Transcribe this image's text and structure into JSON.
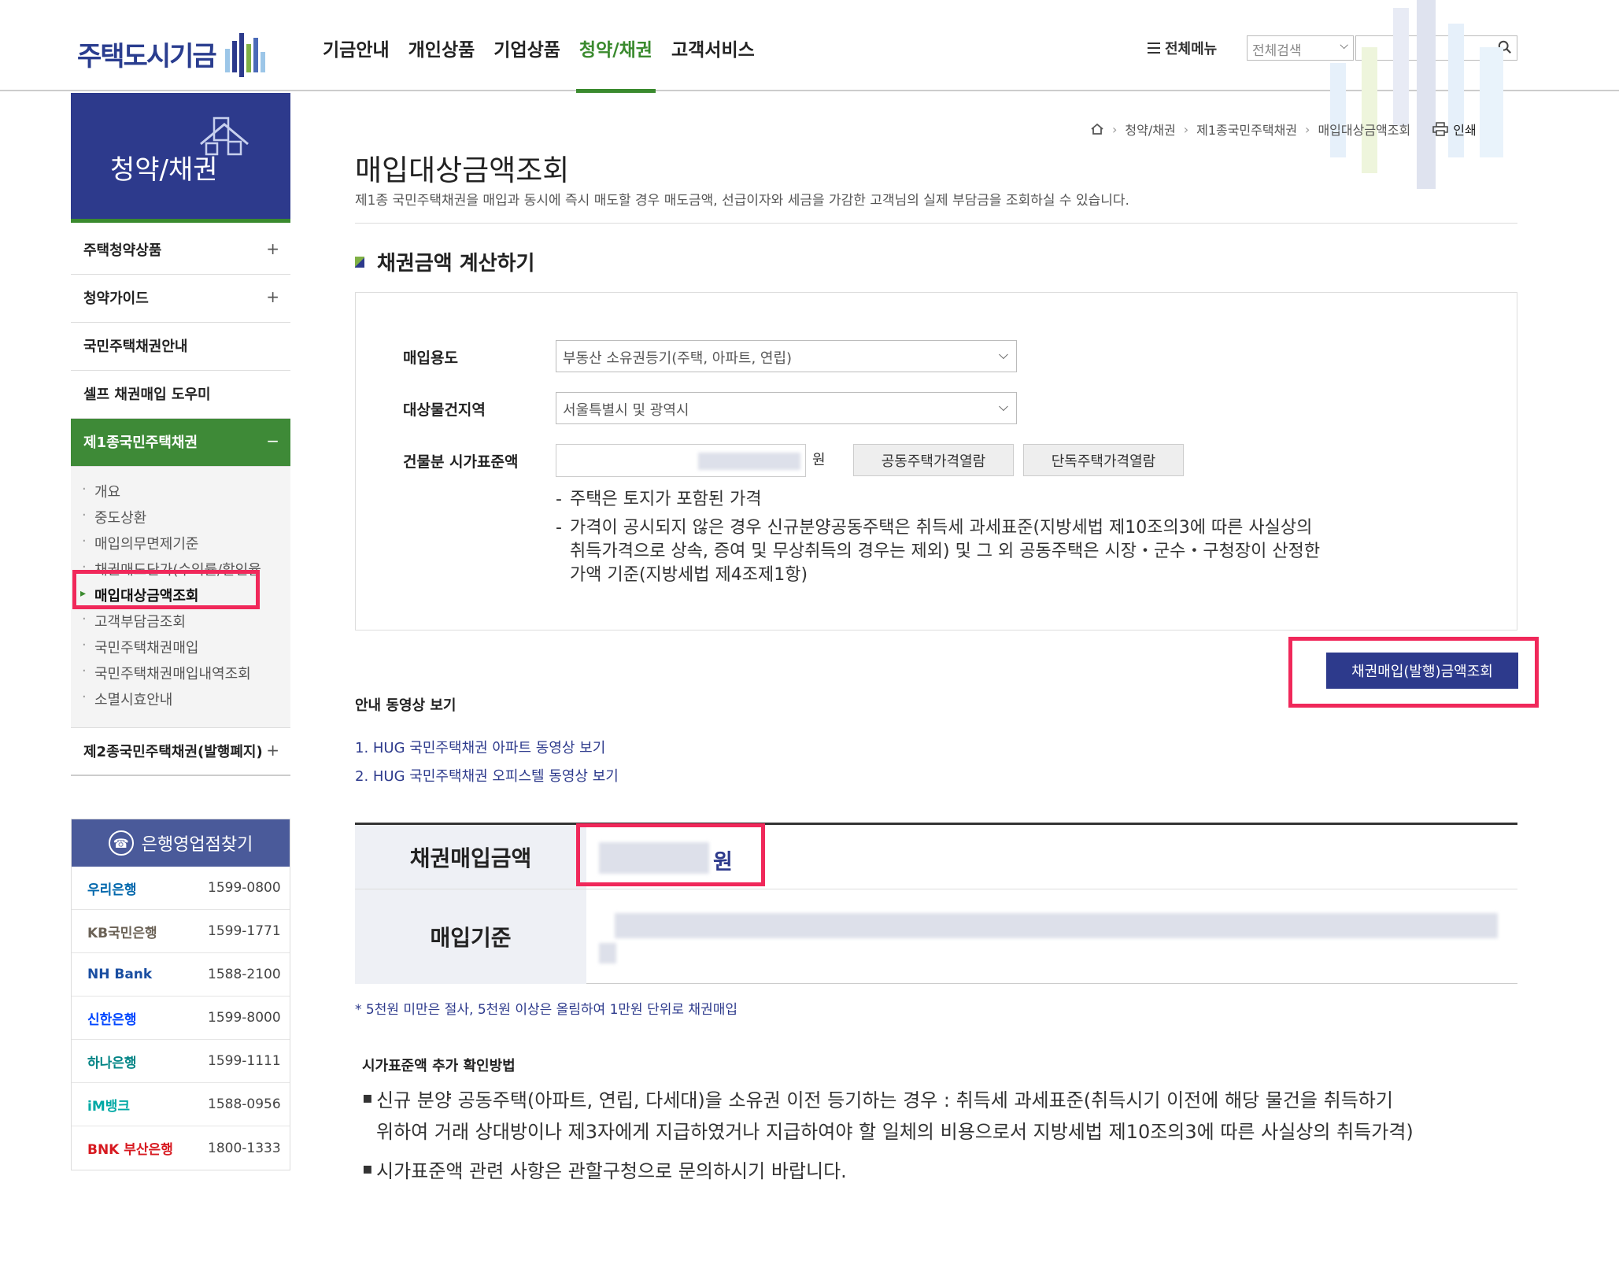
{
  "header": {
    "logo_text": "주택도시기금",
    "nav": [
      "기금안내",
      "개인상품",
      "기업상품",
      "청약/채권",
      "고객서비스"
    ],
    "nav_active": "청약/채권",
    "allmenu_label": "전체메뉴",
    "search_scope": "전체검색",
    "search_value": ""
  },
  "sidebar": {
    "banner_title": "청약/채권",
    "items": [
      {
        "label": "주택청약상품",
        "toggle": "+"
      },
      {
        "label": "청약가이드",
        "toggle": "+"
      },
      {
        "label": "국민주택채권안내",
        "toggle": ""
      },
      {
        "label": "셀프 채권매입 도우미",
        "toggle": ""
      },
      {
        "label": "제1종국민주택채권",
        "toggle": "−"
      }
    ],
    "sub_items": [
      "개요",
      "중도상환",
      "매입의무면제기준",
      "채권매도단가(수익률/할인율",
      "매입대상금액조회",
      "고객부담금조회",
      "국민주택채권매입",
      "국민주택채권매입내역조회",
      "소멸시효안내"
    ],
    "sub_active": "매입대상금액조회",
    "last_item": {
      "label": "제2종국민주택채권(발행폐지)",
      "toggle": "+"
    }
  },
  "banks": {
    "title": "은행영업점찾기",
    "rows": [
      {
        "name": "우리은행",
        "tel": "1599-0800",
        "color": "#0067ac"
      },
      {
        "name": "KB국민은행",
        "tel": "1599-1771",
        "color": "#6b6256"
      },
      {
        "name": "NH Bank",
        "tel": "1588-2100",
        "color": "#1a4ea1"
      },
      {
        "name": "신한은행",
        "tel": "1599-8000",
        "color": "#0046ff"
      },
      {
        "name": "하나은행",
        "tel": "1599-1111",
        "color": "#008485"
      },
      {
        "name": "iM뱅크",
        "tel": "1588-0956",
        "color": "#00a9a5"
      },
      {
        "name": "BNK 부산은행",
        "tel": "1800-1333",
        "color": "#d71920"
      }
    ]
  },
  "breadcrumb": [
    "청약/채권",
    "제1종국민주택채권",
    "매입대상금액조회"
  ],
  "print_label": "인쇄",
  "page": {
    "title": "매입대상금액조회",
    "desc": "제1종 국민주택채권을 매입과 동시에 즉시 매도할 경우 매도금액, 선급이자와 세금을 가감한 고객님의 실제 부담금을 조회하실 수 있습니다.",
    "section_title": "채권금액 계산하기"
  },
  "form": {
    "purpose_label": "매입용도",
    "purpose_value": "부동산 소유권등기(주택, 아파트, 연립)",
    "region_label": "대상물건지역",
    "region_value": "서울특별시 및 광역시",
    "price_label": "건물분 시가표준액",
    "price_unit": "원",
    "btn_apt_price": "공동주택가격열람",
    "btn_house_price": "단독주택가격열람",
    "note1": "주택은 토지가 포함된 가격",
    "note2_line1": "가격이 공시되지 않은 경우 신규분양공동주택은 취득세 과세표준(지방세법 제10조의3에 따른 사실상의",
    "note2_line2": "취득가격으로 상속, 증여 및 무상취득의 경우는 제외) 및 그 외 공동주택은 시장・군수・구청장이 산정한",
    "note2_line3": "가액 기준(지방세법 제4조제1항)"
  },
  "query_button": "채권매입(발행)금액조회",
  "video": {
    "title": "안내 동영상 보기",
    "links": [
      "1. HUG 국민주택채권 아파트 동영상 보기",
      "2. HUG 국민주택채권 오피스텔 동영상 보기"
    ]
  },
  "result": {
    "amount_label": "채권매입금액",
    "amount_unit": "원",
    "basis_label": "매입기준"
  },
  "footnote": "* 5천원 미만은 절사, 5천원 이상은 올림하여 1만원 단위로 채권매입",
  "extra": {
    "title": "시가표준액 추가 확인방법",
    "bullet1_line1": "신규 분양 공동주택(아파트, 연립, 다세대)을 소유권 이전 등기하는 경우 : 취득세 과세표준(취득시기 이전에 해당 물건을 취득하기",
    "bullet1_line2": "위하여 거래 상대방이나 제3자에게 지급하였거나 지급하여야 할 일체의 비용으로서 지방세법 제10조의3에 따른 사실상의 취득가격)",
    "bullet2": "시가표준액 관련 사항은 관할구청으로 문의하시기 바랍니다."
  },
  "colors": {
    "brand_navy": "#2d3a8c",
    "brand_green": "#3a8a2e",
    "highlight_red": "#f0285a"
  }
}
